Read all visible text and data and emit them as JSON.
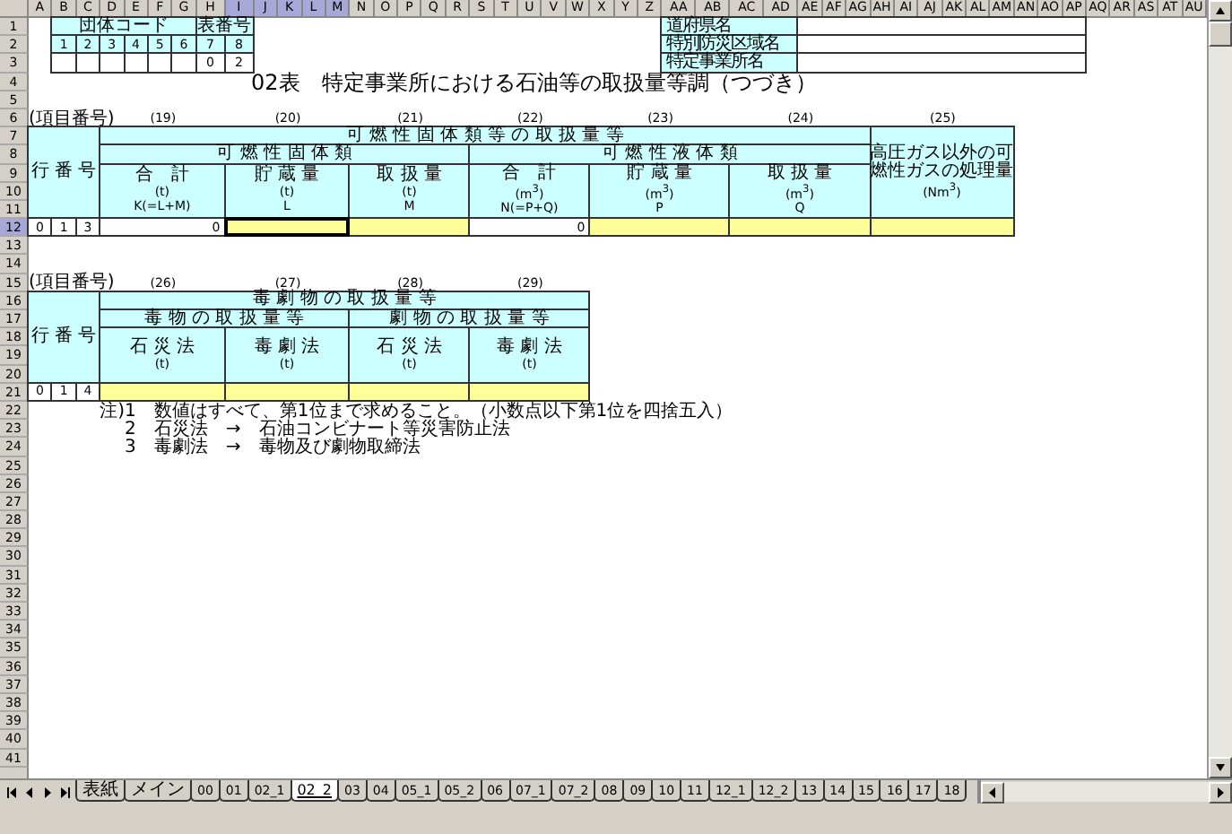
{
  "column_headers": [
    {
      "label": "A",
      "selected": false
    },
    {
      "label": "B",
      "selected": false
    },
    {
      "label": "C",
      "selected": false
    },
    {
      "label": "D",
      "selected": false
    },
    {
      "label": "E",
      "selected": false
    },
    {
      "label": "F",
      "selected": false
    },
    {
      "label": "G",
      "selected": false
    },
    {
      "label": "H",
      "selected": false
    },
    {
      "label": "I",
      "selected": true
    },
    {
      "label": "J",
      "selected": true
    },
    {
      "label": "K",
      "selected": true
    },
    {
      "label": "L",
      "selected": true
    },
    {
      "label": "M",
      "selected": true
    },
    {
      "label": "N",
      "selected": false
    },
    {
      "label": "O",
      "selected": false
    },
    {
      "label": "P",
      "selected": false
    },
    {
      "label": "Q",
      "selected": false
    },
    {
      "label": "R",
      "selected": false
    },
    {
      "label": "S",
      "selected": false
    },
    {
      "label": "T",
      "selected": false
    },
    {
      "label": "U",
      "selected": false
    },
    {
      "label": "V",
      "selected": false
    },
    {
      "label": "W",
      "selected": false
    },
    {
      "label": "X",
      "selected": false
    },
    {
      "label": "Y",
      "selected": false
    },
    {
      "label": "Z",
      "selected": false
    },
    {
      "label": "AA",
      "selected": false
    },
    {
      "label": "AB",
      "selected": false
    },
    {
      "label": "AC",
      "selected": false
    },
    {
      "label": "AD",
      "selected": false
    },
    {
      "label": "AE",
      "selected": false
    },
    {
      "label": "AF",
      "selected": false
    },
    {
      "label": "AG",
      "selected": false
    },
    {
      "label": "AH",
      "selected": false
    },
    {
      "label": "AI",
      "selected": false
    },
    {
      "label": "AJ",
      "selected": false
    },
    {
      "label": "AK",
      "selected": false
    },
    {
      "label": "AL",
      "selected": false
    },
    {
      "label": "AM",
      "selected": false
    },
    {
      "label": "AN",
      "selected": false
    },
    {
      "label": "AO",
      "selected": false
    },
    {
      "label": "AP",
      "selected": false
    },
    {
      "label": "AQ",
      "selected": false
    },
    {
      "label": "AR",
      "selected": false
    },
    {
      "label": "AS",
      "selected": false
    },
    {
      "label": "AT",
      "selected": false
    },
    {
      "label": "AU",
      "selected": false
    }
  ],
  "row_headers": [
    {
      "label": "1",
      "selected": false
    },
    {
      "label": "2",
      "selected": false
    },
    {
      "label": "3",
      "selected": false
    },
    {
      "label": "4",
      "selected": false
    },
    {
      "label": "5",
      "selected": false
    },
    {
      "label": "6",
      "selected": false
    },
    {
      "label": "7",
      "selected": false
    },
    {
      "label": "8",
      "selected": false
    },
    {
      "label": "9",
      "selected": false
    },
    {
      "label": "10",
      "selected": false
    },
    {
      "label": "11",
      "selected": false
    },
    {
      "label": "12",
      "selected": true
    },
    {
      "label": "13",
      "selected": false
    },
    {
      "label": "14",
      "selected": false
    },
    {
      "label": "15",
      "selected": false
    },
    {
      "label": "16",
      "selected": false
    },
    {
      "label": "17",
      "selected": false
    },
    {
      "label": "18",
      "selected": false
    },
    {
      "label": "19",
      "selected": false
    },
    {
      "label": "20",
      "selected": false
    },
    {
      "label": "21",
      "selected": false
    },
    {
      "label": "22",
      "selected": false
    },
    {
      "label": "23",
      "selected": false
    },
    {
      "label": "24",
      "selected": false
    },
    {
      "label": "25",
      "selected": false
    },
    {
      "label": "26",
      "selected": false
    },
    {
      "label": "27",
      "selected": false
    },
    {
      "label": "28",
      "selected": false
    },
    {
      "label": "29",
      "selected": false
    },
    {
      "label": "30",
      "selected": false
    },
    {
      "label": "31",
      "selected": false
    },
    {
      "label": "32",
      "selected": false
    },
    {
      "label": "33",
      "selected": false
    },
    {
      "label": "34",
      "selected": false
    },
    {
      "label": "35",
      "selected": false
    },
    {
      "label": "36",
      "selected": false
    },
    {
      "label": "37",
      "selected": false
    },
    {
      "label": "38",
      "selected": false
    },
    {
      "label": "39",
      "selected": false
    },
    {
      "label": "40",
      "selected": false
    },
    {
      "label": "41",
      "selected": false
    }
  ],
  "code_table": {
    "group_title": "団体コード",
    "table_no_title": "表番号",
    "digits": [
      "1",
      "2",
      "3",
      "4",
      "5",
      "6",
      "7",
      "8"
    ],
    "table_number": [
      "0",
      "2"
    ]
  },
  "region_fields": [
    {
      "label": "道府県名"
    },
    {
      "label": "特別防災区域名"
    },
    {
      "label": "特定事業所名"
    }
  ],
  "title": "02表　特定事業所における石油等の取扱量等調（つづき）",
  "table1": {
    "item_label": "(項目番号)",
    "item_numbers": [
      "(19)",
      "(20)",
      "(21)",
      "(22)",
      "(23)",
      "(24)",
      "(25)"
    ],
    "row_header": "行 番 号",
    "group_title": "可 燃 性 固 体 類 等 の 取 扱 量 等",
    "subgroups": [
      "可 燃 性 固 体 類",
      "可 燃 性 液 体 類"
    ],
    "columns": [
      {
        "name": "合　計",
        "unit": "(t)",
        "symbol": "K(=L+M)"
      },
      {
        "name": "貯 蔵 量",
        "unit": "(t)",
        "symbol": "L"
      },
      {
        "name": "取 扱 量",
        "unit": "(t)",
        "symbol": "M"
      },
      {
        "name": "合　計",
        "unit": "(m$^{3}$)",
        "symbol": "N(=P+Q)"
      },
      {
        "name": "貯 蔵 量",
        "unit": "(m$^{3}$)",
        "symbol": "P"
      },
      {
        "name": "取 扱 量",
        "unit": "(m$^{3}$)",
        "symbol": "Q"
      },
      {
        "name": "高圧ガス以外の可燃性ガスの処理量",
        "unit": "(Nm$^{3}$)"
      }
    ],
    "row": {
      "row_number": [
        "0",
        "1",
        "3"
      ],
      "cells": [
        {
          "kind": "total",
          "value": "0",
          "selected": false
        },
        {
          "kind": "input",
          "selected": true
        },
        {
          "kind": "input",
          "selected": false
        },
        {
          "kind": "total",
          "value": "0",
          "selected": false
        },
        {
          "kind": "input",
          "selected": false
        },
        {
          "kind": "input",
          "selected": false
        },
        {
          "kind": "input",
          "selected": false
        }
      ]
    }
  },
  "table2": {
    "item_label": "(項目番号)",
    "item_numbers": [
      "(26)",
      "(27)",
      "(28)",
      "(29)"
    ],
    "row_header": "行 番 号",
    "group_title": "毒 劇 物 の 取 扱 量 等",
    "subgroups": [
      "毒 物 の 取 扱 量 等",
      "劇 物 の 取 扱 量 等"
    ],
    "columns": [
      {
        "name": "石 災 法",
        "unit": "(t)"
      },
      {
        "name": "毒 劇 法",
        "unit": "(t)"
      },
      {
        "name": "石 災 法",
        "unit": "(t)"
      },
      {
        "name": "毒 劇 法",
        "unit": "(t)"
      }
    ],
    "row": {
      "row_number": [
        "0",
        "1",
        "4"
      ],
      "cells": [
        {
          "kind": "input",
          "selected": false
        },
        {
          "kind": "input",
          "selected": false
        },
        {
          "kind": "input",
          "selected": false
        },
        {
          "kind": "input",
          "selected": false
        }
      ]
    }
  },
  "notes": {
    "mark": "注)",
    "items": [
      "1　数値はすべて、第1位まで求めること。（小数点以下第1位を四捨五入）",
      "2　石災法　→　石油コンビナート等災害防止法",
      "3　毒劇法　→　毒物及び劇物取締法"
    ]
  },
  "sheet_tabs": [
    {
      "label": "表紙",
      "selected": false
    },
    {
      "label": "メイン",
      "selected": false
    },
    {
      "label": "00",
      "selected": false
    },
    {
      "label": "01",
      "selected": false
    },
    {
      "label": "02_1",
      "selected": false
    },
    {
      "label": "02_2",
      "selected": true
    },
    {
      "label": "03",
      "selected": false
    },
    {
      "label": "04",
      "selected": false
    },
    {
      "label": "05_1",
      "selected": false
    },
    {
      "label": "05_2",
      "selected": false
    },
    {
      "label": "06",
      "selected": false
    },
    {
      "label": "07_1",
      "selected": false
    },
    {
      "label": "07_2",
      "selected": false
    },
    {
      "label": "08",
      "selected": false
    },
    {
      "label": "09",
      "selected": false
    },
    {
      "label": "10",
      "selected": false
    },
    {
      "label": "11",
      "selected": false
    },
    {
      "label": "12_1",
      "selected": false
    },
    {
      "label": "12_2",
      "selected": false
    },
    {
      "label": "13",
      "selected": false
    },
    {
      "label": "14",
      "selected": false
    },
    {
      "label": "15",
      "selected": false
    },
    {
      "label": "16",
      "selected": false
    },
    {
      "label": "17",
      "selected": false
    },
    {
      "label": "18",
      "selected": false
    }
  ]
}
